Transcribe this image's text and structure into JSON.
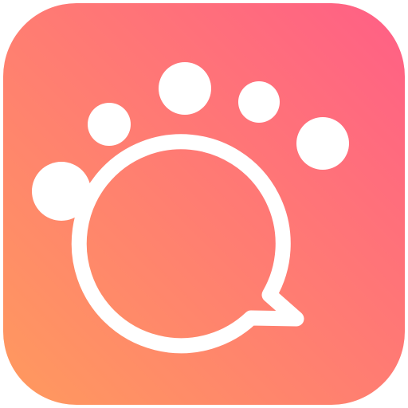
{
  "app_icon": {
    "icon_name": "paw-chat-bubble-icon",
    "colors": {
      "gradient_start": "#FF9A5E",
      "gradient_end": "#FF5F86",
      "glyph": "#FFFFFF"
    }
  }
}
